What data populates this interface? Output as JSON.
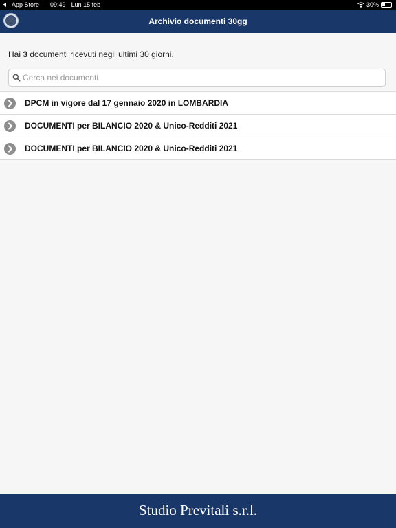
{
  "status_bar": {
    "back_label": "App Store",
    "time": "09:49",
    "date": "Lun 15 feb",
    "battery_percent": "30%",
    "battery_level": 0.3
  },
  "nav": {
    "title": "Archivio documenti 30gg",
    "menu_icon": "menu-icon"
  },
  "summary": {
    "prefix": "Hai ",
    "count": "3",
    "suffix": " documenti ricevuti negli ultimi 30 giorni."
  },
  "search": {
    "placeholder": "Cerca nei documenti",
    "value": "",
    "icon": "search-icon"
  },
  "documents": [
    {
      "title": "DPCM in vigore dal 17 gennaio 2020 in LOMBARDIA"
    },
    {
      "title": "DOCUMENTI per BILANCIO 2020 & Unico-Redditi 2021"
    },
    {
      "title": "DOCUMENTI per BILANCIO 2020 & Unico-Redditi 2021"
    }
  ],
  "footer": {
    "logo_text": "Studio Previtali s.r.l."
  },
  "colors": {
    "brand_navy": "#193869",
    "background": "#f7f6f7",
    "chevron_gray": "#8d8d8d"
  }
}
